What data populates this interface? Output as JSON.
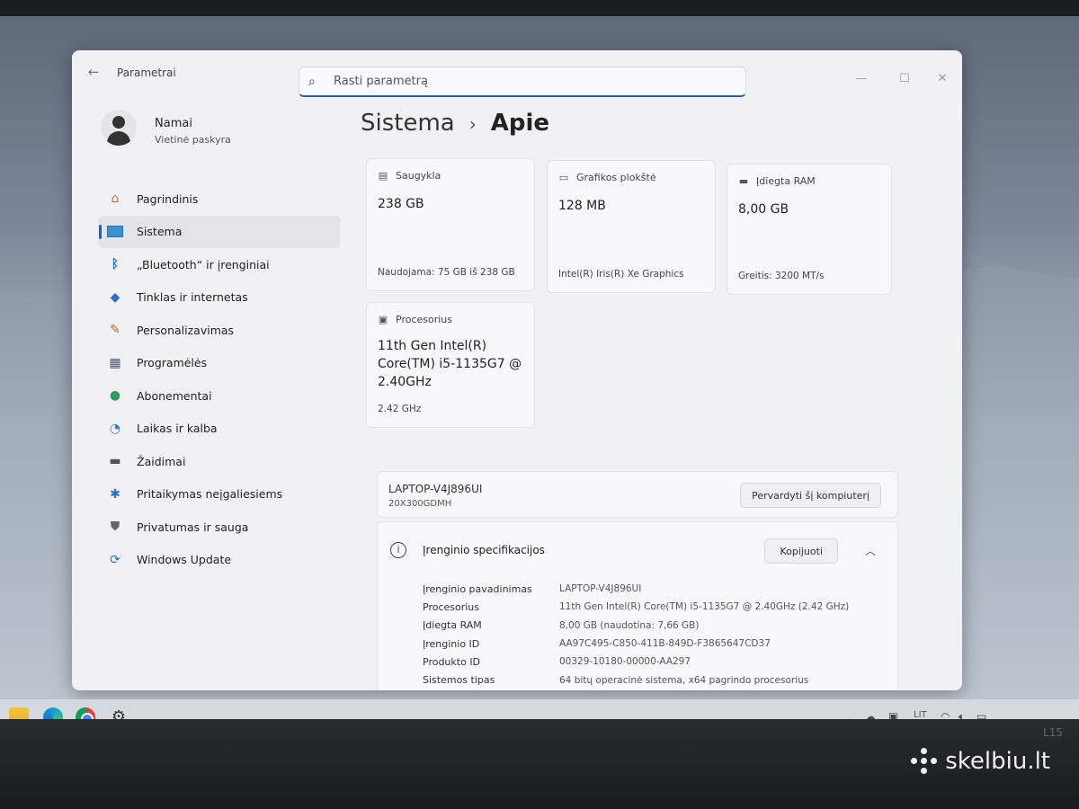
{
  "window": {
    "title": "Parametrai",
    "search_placeholder": "Rasti parametrą"
  },
  "profile": {
    "name": "Namai",
    "account_type": "Vietinė paskyra"
  },
  "sidebar": {
    "items": [
      {
        "label": "Pagrindinis",
        "icon": "home-icon"
      },
      {
        "label": "Sistema",
        "icon": "monitor-icon",
        "active": true
      },
      {
        "label": "„Bluetooth“ ir įrenginiai",
        "icon": "bluetooth-icon"
      },
      {
        "label": "Tinklas ir internetas",
        "icon": "wifi-icon"
      },
      {
        "label": "Personalizavimas",
        "icon": "brush-icon"
      },
      {
        "label": "Programėlės",
        "icon": "apps-icon"
      },
      {
        "label": "Abonementai",
        "icon": "person-icon"
      },
      {
        "label": "Laikas ir kalba",
        "icon": "globe-clock-icon"
      },
      {
        "label": "Žaidimai",
        "icon": "gamepad-icon"
      },
      {
        "label": "Pritaikymas neįgaliesiems",
        "icon": "accessibility-icon"
      },
      {
        "label": "Privatumas ir sauga",
        "icon": "shield-icon"
      },
      {
        "label": "Windows Update",
        "icon": "update-icon"
      }
    ]
  },
  "breadcrumb": {
    "parent": "Sistema",
    "separator": "›",
    "current": "Apie"
  },
  "cards": {
    "storage": {
      "label": "Saugykla",
      "value": "238 GB",
      "foot": "Naudojama: 75 GB iš 238 GB"
    },
    "gpu": {
      "label": "Grafikos plokštė",
      "value": "128 MB",
      "foot": "Intel(R) Iris(R) Xe Graphics"
    },
    "ram": {
      "label": "Įdiegta RAM",
      "value": "8,00 GB",
      "foot": "Greitis: 3200 MT/s"
    },
    "cpu": {
      "label": "Procesorius",
      "value_line1": "11th Gen Intel(R)",
      "value_line2": "Core(TM) i5-1135G7 @",
      "value_line3": "2.40GHz",
      "foot": "2.42 GHz"
    }
  },
  "device": {
    "name": "LAPTOP-V4J896UI",
    "model": "20X300GDMH",
    "rename_label": "Pervardyti šį kompiuterį"
  },
  "specs": {
    "title": "Įrenginio specifikacijos",
    "copy_label": "Kopijuoti",
    "rows": [
      {
        "key": "Įrenginio pavadinimas",
        "value": "LAPTOP-V4J896UI"
      },
      {
        "key": "Procesorius",
        "value": "11th Gen Intel(R) Core(TM) i5-1135G7 @ 2.40GHz (2.42 GHz)"
      },
      {
        "key": "Įdiegta RAM",
        "value": "8,00 GB (naudotina: 7,66 GB)"
      },
      {
        "key": "Įrenginio ID",
        "value": "AA97C495-C850-411B-849D-F3865647CD37"
      },
      {
        "key": "Produkto ID",
        "value": "00329-10180-00000-AA297"
      },
      {
        "key": "Sistemos tipas",
        "value": "64 bitų operacinė sistema, x64 pagrindo procesorius"
      }
    ]
  },
  "taskbar": {
    "language": "LIT"
  },
  "bezel": {
    "model_mark": "L15"
  },
  "watermark": {
    "text": "skelbiu.lt"
  }
}
